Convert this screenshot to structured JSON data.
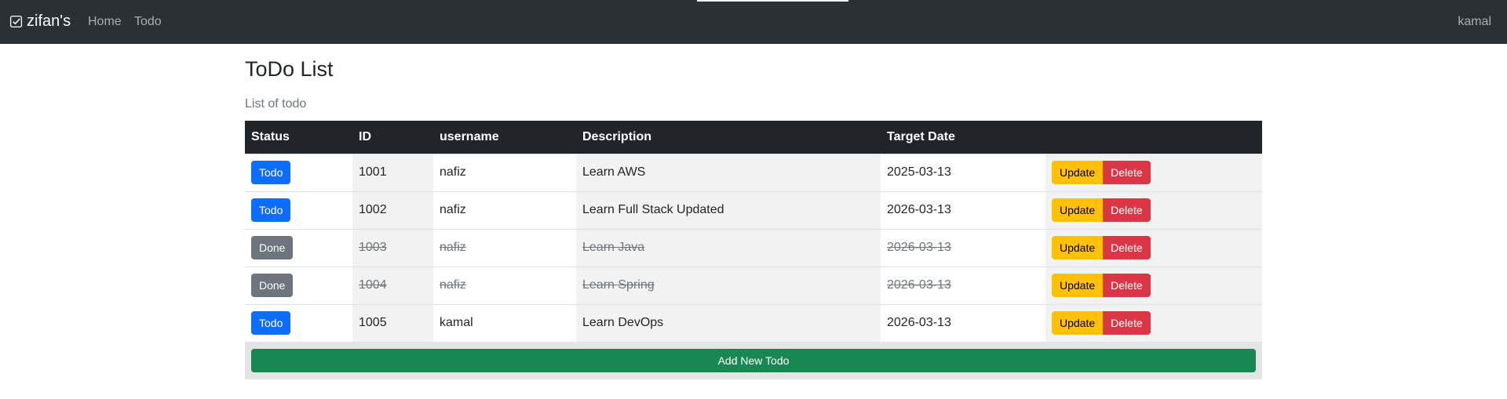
{
  "navbar": {
    "brand": "zifan's",
    "brand_icon": "checkbox-icon",
    "links": [
      "Home",
      "Todo"
    ],
    "user": "kamal",
    "bg_color": "#2b3035"
  },
  "page": {
    "title": "ToDo List",
    "subtitle": "List of todo"
  },
  "table": {
    "headers": [
      "Status",
      "ID",
      "username",
      "Description",
      "Target Date",
      ""
    ],
    "rows": [
      {
        "status": "Todo",
        "done": false,
        "id": "1001",
        "username": "nafiz",
        "description": "Learn AWS",
        "target_date": "2025-03-13"
      },
      {
        "status": "Todo",
        "done": false,
        "id": "1002",
        "username": "nafiz",
        "description": "Learn Full Stack Updated",
        "target_date": "2026-03-13"
      },
      {
        "status": "Done",
        "done": true,
        "id": "1003",
        "username": "nafiz",
        "description": "Learn Java",
        "target_date": "2026-03-13"
      },
      {
        "status": "Done",
        "done": true,
        "id": "1004",
        "username": "nafiz",
        "description": "Learn Spring",
        "target_date": "2026-03-13"
      },
      {
        "status": "Todo",
        "done": false,
        "id": "1005",
        "username": "kamal",
        "description": "Learn DevOps",
        "target_date": "2026-03-13"
      }
    ],
    "actions": {
      "update_label": "Update",
      "delete_label": "Delete"
    }
  },
  "footer": {
    "add_label": "Add New Todo"
  },
  "colors": {
    "todo_badge": "#0d6efd",
    "done_badge": "#6c757d",
    "update": "#ffc107",
    "delete": "#dc3545",
    "add": "#198754"
  }
}
